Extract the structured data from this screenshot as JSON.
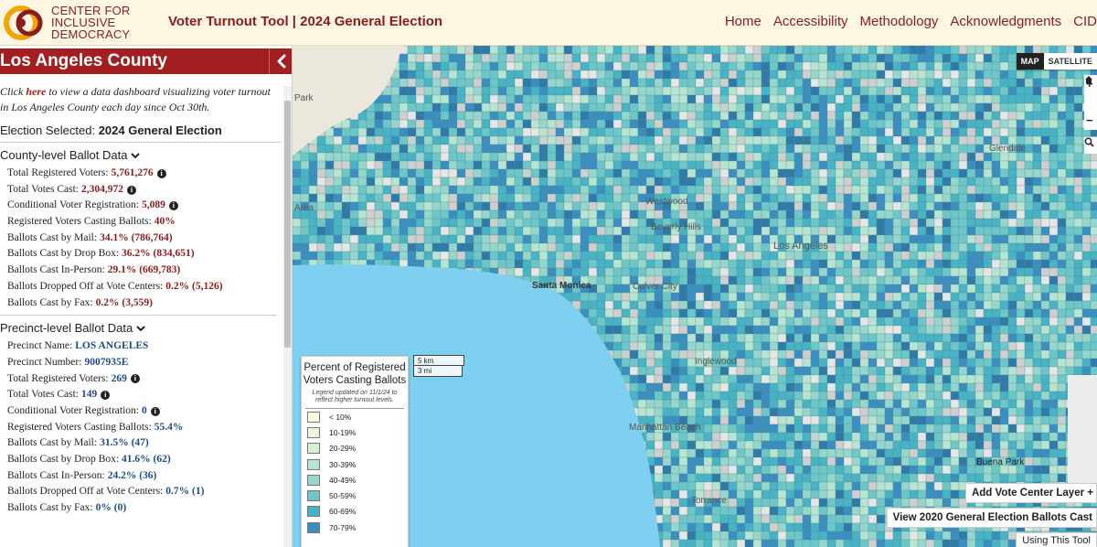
{
  "org": {
    "line1": "CENTER FOR",
    "line2": "INCLUSIVE",
    "line3": "DEMOCRACY",
    "colors": {
      "brand": "#8b1c1c",
      "accent": "#f0a500"
    }
  },
  "app_title": "Voter Turnout Tool | 2024 General Election",
  "nav": [
    "Home",
    "Accessibility",
    "Methodology",
    "Acknowledgments",
    "CID"
  ],
  "sidebar": {
    "county": "Los Angeles County",
    "collapse_icon": "chevron-left-icon",
    "intro_prefix": "Click ",
    "intro_link": "here",
    "intro_suffix": " to view a data dashboard visualizing voter turnout in Los Angeles County each day since Oct 30th.",
    "election_label": "Election Selected: ",
    "election_value": "2024 General Election",
    "county_section": {
      "title": "County-level Ballot Data",
      "rows": [
        {
          "label": "Total Registered Voters:",
          "value": "5,761,276",
          "info": true
        },
        {
          "label": "Total Votes Cast:",
          "value": "2,304,972",
          "info": true
        },
        {
          "label": "Conditional Voter Registration:",
          "value": "5,089",
          "info": true
        },
        {
          "label": "Registered Voters Casting Ballots:",
          "value": "40%",
          "info": false
        },
        {
          "label": "Ballots Cast by Mail:",
          "value": "34.1% (786,764)",
          "info": false
        },
        {
          "label": "Ballots Cast by Drop Box:",
          "value": "36.2% (834,651)",
          "info": false
        },
        {
          "label": "Ballots Cast In-Person:",
          "value": "29.1% (669,783)",
          "info": false
        },
        {
          "label": "Ballots Dropped Off at Vote Centers:",
          "value": "0.2% (5,126)",
          "info": false
        },
        {
          "label": "Ballots Cast by Fax:",
          "value": "0.2% (3,559)",
          "info": false
        }
      ]
    },
    "precinct_section": {
      "title": "Precinct-level Ballot Data",
      "rows": [
        {
          "label": "Precinct Name:",
          "value": "LOS ANGELES",
          "info": false
        },
        {
          "label": "Precinct Number:",
          "value": "9007935E",
          "info": false
        },
        {
          "label": "Total Registered Voters:",
          "value": "269",
          "info": true
        },
        {
          "label": "Total Votes Cast:",
          "value": "149",
          "info": true
        },
        {
          "label": "Conditional Voter Registration:",
          "value": "0",
          "info": true
        },
        {
          "label": "Registered Voters Casting Ballots:",
          "value": "55.4%",
          "info": false
        },
        {
          "label": "Ballots Cast by Mail:",
          "value": "31.5% (47)",
          "info": false
        },
        {
          "label": "Ballots Cast by Drop Box:",
          "value": "41.6% (62)",
          "info": false
        },
        {
          "label": "Ballots Cast In-Person:",
          "value": "24.2% (36)",
          "info": false
        },
        {
          "label": "Ballots Dropped Off at Vote Centers:",
          "value": "0.7% (1)",
          "info": false
        },
        {
          "label": "Ballots Cast by Fax:",
          "value": "0% (0)",
          "info": false
        }
      ]
    }
  },
  "map": {
    "map_type": [
      "MAP",
      "SATELLITE"
    ],
    "zoom_in": "+",
    "home_icon": "home-icon",
    "zoom_out": "−",
    "search_icon": "search-icon",
    "place_labels": [
      "Park",
      "Santa Monica",
      "Beverly Hills",
      "Los Angeles",
      "Inglewood",
      "Manhattan Beach",
      "Buena Park",
      "Torrance",
      "Westwood",
      "Culver City",
      "Area",
      "Glendale"
    ],
    "legend": {
      "title": "Percent of Registered Voters Casting Ballots",
      "note": "Legend updated on 11/1/24 to reflect higher turnout levels.",
      "items": [
        {
          "label": "< 10%",
          "color": "#fbfde0"
        },
        {
          "label": "10-19%",
          "color": "#ebf7df"
        },
        {
          "label": "20-29%",
          "color": "#d5efd5"
        },
        {
          "label": "30-39%",
          "color": "#b8e4d2"
        },
        {
          "label": "40-49%",
          "color": "#96d6cc"
        },
        {
          "label": "50-59%",
          "color": "#6dc7c8"
        },
        {
          "label": "60-69%",
          "color": "#47b3c5"
        },
        {
          "label": "70-79%",
          "color": "#3b8fc0"
        }
      ]
    },
    "scale": [
      "5 km",
      "3 mi"
    ],
    "add_layer_btn": "Add Vote Center Layer",
    "view_2020_btn": "View 2020 General Election Ballots Cast",
    "using_btn": "Using This Tool"
  }
}
